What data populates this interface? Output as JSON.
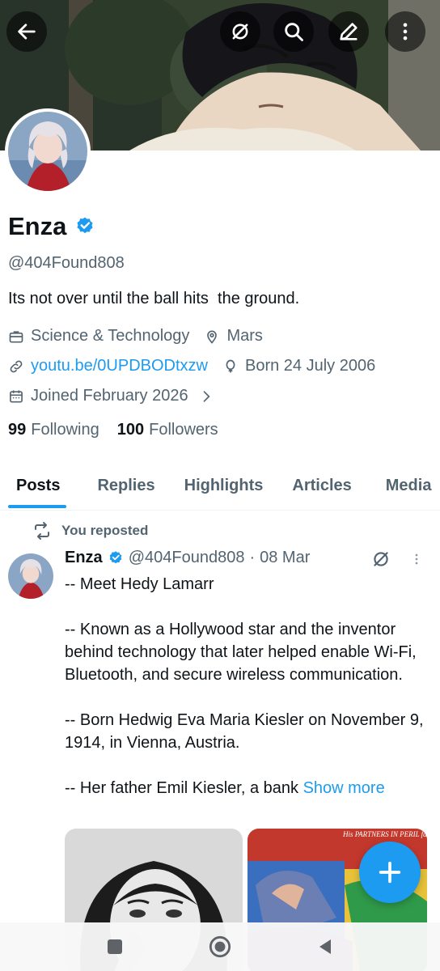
{
  "profile": {
    "name": "Enza",
    "handle": "@404Found808",
    "bio": "Its not over until the ball hits  the ground.",
    "category": "Science & Technology",
    "location": "Mars",
    "website": "youtu.be/0UPDBODtxzw",
    "born": "Born 24 July 2006",
    "joined": "Joined February 2026",
    "following_count": "99",
    "following_label": "Following",
    "followers_count": "100",
    "followers_label": "Followers"
  },
  "tabs": [
    {
      "label": "Posts",
      "active": true
    },
    {
      "label": "Replies"
    },
    {
      "label": "Highlights"
    },
    {
      "label": "Articles"
    },
    {
      "label": "Media"
    }
  ],
  "post": {
    "repost_label": "You reposted",
    "author": "Enza",
    "handle": "@404Found808",
    "separator": "·",
    "date": "08 Mar",
    "lines": [
      "-- Meet Hedy Lamarr",
      "-- Known as a Hollywood star and the inventor behind technology that later helped enable Wi-Fi, Bluetooth, and secure wireless communication.",
      "-- Born Hedwig Eva Maria Kiesler on November 9, 1914, in Vienna, Austria.",
      "-- Her father Emil Kiesler, a bank"
    ],
    "show_more": "Show more",
    "comic_caption": "His PARTNERS IN PERIL face the steel-clawed fury of The"
  },
  "icons": {
    "back": "arrow-left-icon",
    "grok": "grok-icon",
    "search": "search-icon",
    "edit": "pen-icon",
    "more": "more-vertical-icon",
    "compose": "plus-icon"
  },
  "colors": {
    "accent": "#1d9bf0",
    "text": "#0f1419",
    "secondary": "#536471"
  }
}
